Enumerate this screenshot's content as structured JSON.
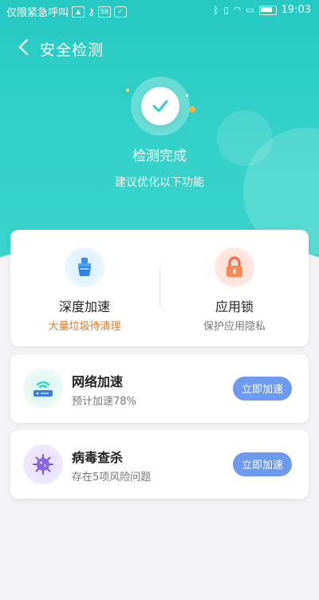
{
  "status_bar": {
    "carrier": "仅限紧急呼叫",
    "time": "19:03"
  },
  "nav": {
    "back_symbol": "〈",
    "title": "安全检测"
  },
  "result": {
    "title": "检测完成",
    "subtitle": "建议优化以下功能"
  },
  "features": [
    {
      "label": "深度加速",
      "sub": "大量垃圾待清理",
      "icon": "broom-cleaner-icon"
    },
    {
      "label": "应用锁",
      "sub": "保护应用隐私",
      "icon": "lock-icon"
    }
  ],
  "rows": [
    {
      "title": "网络加速",
      "sub": "预计加速78%",
      "button": "立即加速",
      "icon": "wifi-router-icon"
    },
    {
      "title": "病毒查杀",
      "sub": "存在5项风险问题",
      "button": "立即加速",
      "icon": "virus-icon"
    }
  ],
  "colors": {
    "header_teal": "#2fcfc6",
    "accent_button": "#6d9aef",
    "warning_orange": "#e07a2b"
  }
}
